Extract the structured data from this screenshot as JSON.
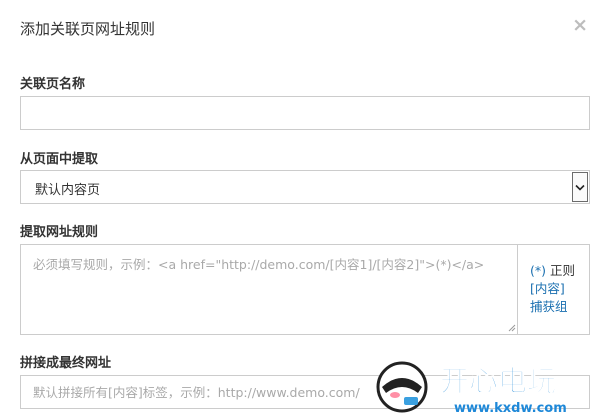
{
  "dialog": {
    "title": "添加关联页网址规则",
    "close_label": "×"
  },
  "fields": {
    "page_name": {
      "label": "关联页名称",
      "value": "",
      "placeholder": ""
    },
    "extract_from": {
      "label": "从页面中提取",
      "selected": "默认内容页"
    },
    "url_rule": {
      "label": "提取网址规则",
      "placeholder": "必须填写规则，示例：<a href=\"http://demo.com/[内容1]/[内容2]\">(*)</a>",
      "help": {
        "wildcard": "(*)",
        "regex": "正则",
        "content": "[内容]",
        "capture_group": "捕获组"
      }
    },
    "final_url": {
      "label": "拼接成最终网址",
      "placeholder": "默认拼接所有[内容]标签，示例：http://www.demo.com/"
    }
  },
  "watermark": {
    "brand": "开心电玩",
    "domain": "www.kxdw.com"
  },
  "colors": {
    "link": "#1a6fb0",
    "border": "#cccccc",
    "brand_blue": "#1e88d8"
  }
}
